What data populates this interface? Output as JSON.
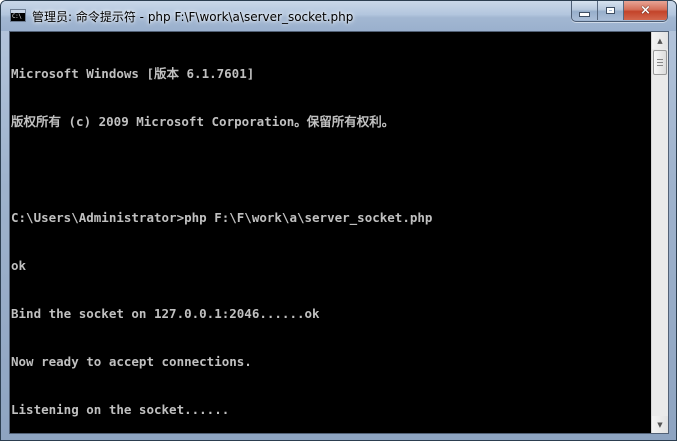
{
  "window": {
    "title": "管理员: 命令提示符 - php  F:\\F\\work\\a\\server_socket.php",
    "icon_text": "C:\\",
    "controls": {
      "minimize": "minimize-icon",
      "maximize": "maximize-icon",
      "close": "×"
    }
  },
  "console": {
    "lines": [
      "Microsoft Windows [版本 6.1.7601]",
      "版权所有 (c) 2009 Microsoft Corporation。保留所有权利。",
      "",
      "C:\\Users\\Administrator>php F:\\F\\work\\a\\server_socket.php",
      "ok",
      "Bind the socket on 127.0.0.1:2046......ok",
      "Now ready to accept connections.",
      "Listening on the socket......"
    ]
  },
  "scrollbar": {
    "up_arrow": "▲",
    "down_arrow": "▼"
  },
  "colors": {
    "console_bg": "#000000",
    "console_fg": "#c0c0c0",
    "close_button": "#c3432a"
  }
}
